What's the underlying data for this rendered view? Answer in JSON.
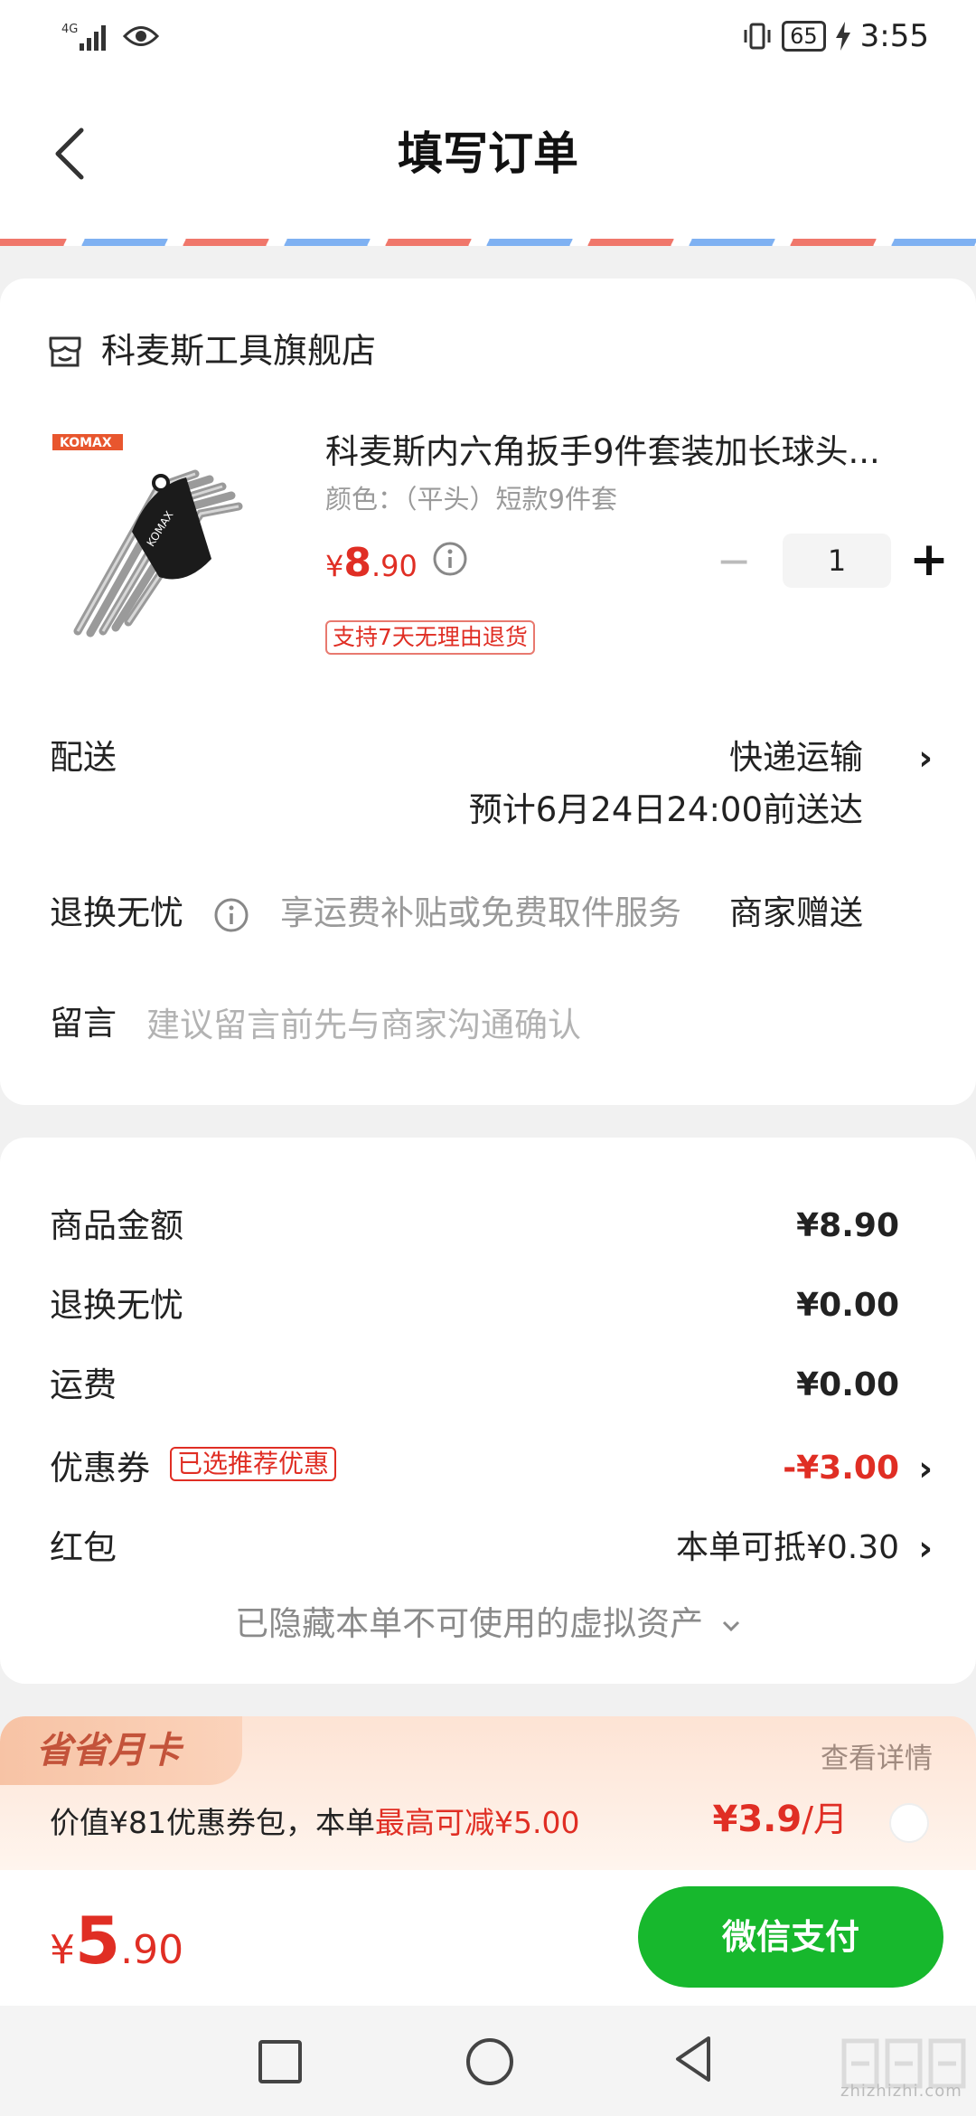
{
  "status_bar": {
    "network": "4G",
    "battery": "65",
    "time": "3:55"
  },
  "header": {
    "title": "填写订单"
  },
  "shop": {
    "name": "科麦斯工具旗舰店",
    "product": {
      "brand_logo_text": "KOMAX",
      "title": "科麦斯内六角扳手9件套装加长球头...",
      "spec": "颜色：（平头）短款9件套",
      "price_symbol": "¥",
      "price_int": "8",
      "price_dec": ".90",
      "quantity": "1",
      "minus_label": "−",
      "plus_label": "+",
      "return_tag": "支持7天无理由退货"
    },
    "shipping": {
      "label": "配送",
      "method": "快递运输",
      "eta": "预计6月24日24:00前送达"
    },
    "return_worry_free": {
      "label": "退换无忧",
      "desc": "享运费补贴或免费取件服务",
      "value": "商家赠送"
    },
    "message": {
      "label": "留言",
      "placeholder": "建议留言前先与商家沟通确认"
    }
  },
  "summary": {
    "goods_label": "商品金额",
    "goods_value": "¥8.90",
    "return_label": "退换无忧",
    "return_value": "¥0.00",
    "freight_label": "运费",
    "freight_value": "¥0.00",
    "coupon_label": "优惠券",
    "coupon_tag": "已选推荐优惠",
    "coupon_value": "-¥3.00",
    "redpacket_label": "红包",
    "redpacket_value": "本单可抵¥0.30",
    "hidden_assets": "已隐藏本单不可使用的虚拟资产"
  },
  "month_card": {
    "badge": "省省月卡",
    "detail_link": "查看详情",
    "desc_prefix": "价值¥81优惠券包，本单",
    "desc_highlight": "最高可减¥5.00",
    "price": "¥3.9",
    "unit": "/月"
  },
  "pay_bar": {
    "total_symbol": "¥",
    "total_int": "5",
    "total_dec": ".90",
    "pay_button": "微信支付"
  },
  "watermark": {
    "text": "zhizhizhi.com"
  },
  "colors": {
    "accent_red": "#e02e24",
    "pay_green": "#17b82d",
    "airmail_red": "#f0776b",
    "airmail_blue": "#7fb1f2"
  }
}
